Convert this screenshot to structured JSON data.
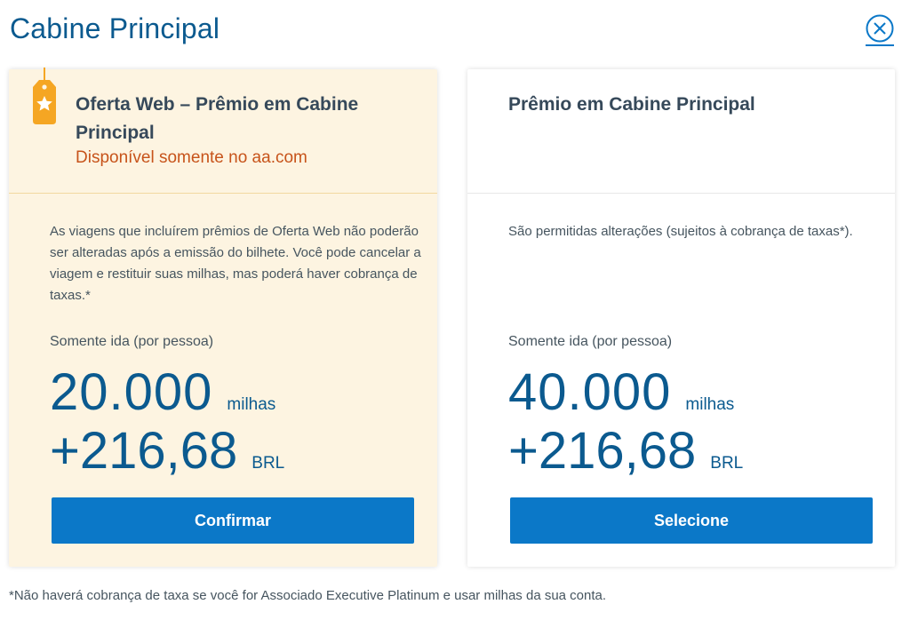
{
  "page": {
    "title": "Cabine Principal",
    "close_icon": "close-circle-icon",
    "footnote": "*Não haverá cobrança de taxa se você for Associado Executive Platinum e usar milhas da sua conta."
  },
  "colors": {
    "accent": "#0b78c8",
    "title_blue": "#0b5a8f",
    "offer_bg": "#fdf4e1",
    "offer_subtitle": "#c7531a",
    "tag": "#f5a623"
  },
  "cards": [
    {
      "badge_icon": "star-tag-icon",
      "title": "Oferta Web – Prêmio em Cabine Principal",
      "subtitle": "Disponível somente no aa.com",
      "description": "As viagens que incluírem prêmios de Oferta Web não poderão ser alteradas após a emissão do bilhete. Você pode cancelar a viagem e restituir suas milhas, mas poderá haver cobrança de taxas.*",
      "per_person": "Somente ida (por pessoa)",
      "miles": "20.000",
      "miles_unit": "milhas",
      "fee": "+216,68",
      "fee_unit": "BRL",
      "button": "Confirmar"
    },
    {
      "title": "Prêmio em Cabine Principal",
      "description": "São permitidas alterações (sujeitos à cobrança de taxas*).",
      "per_person": "Somente ida (por pessoa)",
      "miles": "40.000",
      "miles_unit": "milhas",
      "fee": "+216,68",
      "fee_unit": "BRL",
      "button": "Selecione"
    }
  ]
}
